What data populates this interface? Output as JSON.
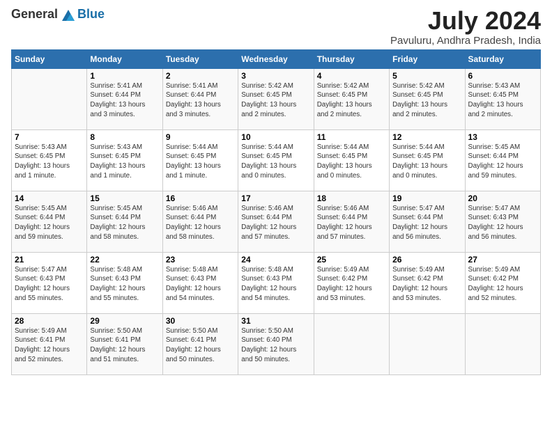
{
  "header": {
    "logo_general": "General",
    "logo_blue": "Blue",
    "month_title": "July 2024",
    "location": "Pavuluru, Andhra Pradesh, India"
  },
  "columns": [
    "Sunday",
    "Monday",
    "Tuesday",
    "Wednesday",
    "Thursday",
    "Friday",
    "Saturday"
  ],
  "weeks": [
    [
      {
        "day": "",
        "info": ""
      },
      {
        "day": "1",
        "info": "Sunrise: 5:41 AM\nSunset: 6:44 PM\nDaylight: 13 hours\nand 3 minutes."
      },
      {
        "day": "2",
        "info": "Sunrise: 5:41 AM\nSunset: 6:44 PM\nDaylight: 13 hours\nand 3 minutes."
      },
      {
        "day": "3",
        "info": "Sunrise: 5:42 AM\nSunset: 6:45 PM\nDaylight: 13 hours\nand 2 minutes."
      },
      {
        "day": "4",
        "info": "Sunrise: 5:42 AM\nSunset: 6:45 PM\nDaylight: 13 hours\nand 2 minutes."
      },
      {
        "day": "5",
        "info": "Sunrise: 5:42 AM\nSunset: 6:45 PM\nDaylight: 13 hours\nand 2 minutes."
      },
      {
        "day": "6",
        "info": "Sunrise: 5:43 AM\nSunset: 6:45 PM\nDaylight: 13 hours\nand 2 minutes."
      }
    ],
    [
      {
        "day": "7",
        "info": "Sunrise: 5:43 AM\nSunset: 6:45 PM\nDaylight: 13 hours\nand 1 minute."
      },
      {
        "day": "8",
        "info": "Sunrise: 5:43 AM\nSunset: 6:45 PM\nDaylight: 13 hours\nand 1 minute."
      },
      {
        "day": "9",
        "info": "Sunrise: 5:44 AM\nSunset: 6:45 PM\nDaylight: 13 hours\nand 1 minute."
      },
      {
        "day": "10",
        "info": "Sunrise: 5:44 AM\nSunset: 6:45 PM\nDaylight: 13 hours\nand 0 minutes."
      },
      {
        "day": "11",
        "info": "Sunrise: 5:44 AM\nSunset: 6:45 PM\nDaylight: 13 hours\nand 0 minutes."
      },
      {
        "day": "12",
        "info": "Sunrise: 5:44 AM\nSunset: 6:45 PM\nDaylight: 13 hours\nand 0 minutes."
      },
      {
        "day": "13",
        "info": "Sunrise: 5:45 AM\nSunset: 6:44 PM\nDaylight: 12 hours\nand 59 minutes."
      }
    ],
    [
      {
        "day": "14",
        "info": "Sunrise: 5:45 AM\nSunset: 6:44 PM\nDaylight: 12 hours\nand 59 minutes."
      },
      {
        "day": "15",
        "info": "Sunrise: 5:45 AM\nSunset: 6:44 PM\nDaylight: 12 hours\nand 58 minutes."
      },
      {
        "day": "16",
        "info": "Sunrise: 5:46 AM\nSunset: 6:44 PM\nDaylight: 12 hours\nand 58 minutes."
      },
      {
        "day": "17",
        "info": "Sunrise: 5:46 AM\nSunset: 6:44 PM\nDaylight: 12 hours\nand 57 minutes."
      },
      {
        "day": "18",
        "info": "Sunrise: 5:46 AM\nSunset: 6:44 PM\nDaylight: 12 hours\nand 57 minutes."
      },
      {
        "day": "19",
        "info": "Sunrise: 5:47 AM\nSunset: 6:44 PM\nDaylight: 12 hours\nand 56 minutes."
      },
      {
        "day": "20",
        "info": "Sunrise: 5:47 AM\nSunset: 6:43 PM\nDaylight: 12 hours\nand 56 minutes."
      }
    ],
    [
      {
        "day": "21",
        "info": "Sunrise: 5:47 AM\nSunset: 6:43 PM\nDaylight: 12 hours\nand 55 minutes."
      },
      {
        "day": "22",
        "info": "Sunrise: 5:48 AM\nSunset: 6:43 PM\nDaylight: 12 hours\nand 55 minutes."
      },
      {
        "day": "23",
        "info": "Sunrise: 5:48 AM\nSunset: 6:43 PM\nDaylight: 12 hours\nand 54 minutes."
      },
      {
        "day": "24",
        "info": "Sunrise: 5:48 AM\nSunset: 6:43 PM\nDaylight: 12 hours\nand 54 minutes."
      },
      {
        "day": "25",
        "info": "Sunrise: 5:49 AM\nSunset: 6:42 PM\nDaylight: 12 hours\nand 53 minutes."
      },
      {
        "day": "26",
        "info": "Sunrise: 5:49 AM\nSunset: 6:42 PM\nDaylight: 12 hours\nand 53 minutes."
      },
      {
        "day": "27",
        "info": "Sunrise: 5:49 AM\nSunset: 6:42 PM\nDaylight: 12 hours\nand 52 minutes."
      }
    ],
    [
      {
        "day": "28",
        "info": "Sunrise: 5:49 AM\nSunset: 6:41 PM\nDaylight: 12 hours\nand 52 minutes."
      },
      {
        "day": "29",
        "info": "Sunrise: 5:50 AM\nSunset: 6:41 PM\nDaylight: 12 hours\nand 51 minutes."
      },
      {
        "day": "30",
        "info": "Sunrise: 5:50 AM\nSunset: 6:41 PM\nDaylight: 12 hours\nand 50 minutes."
      },
      {
        "day": "31",
        "info": "Sunrise: 5:50 AM\nSunset: 6:40 PM\nDaylight: 12 hours\nand 50 minutes."
      },
      {
        "day": "",
        "info": ""
      },
      {
        "day": "",
        "info": ""
      },
      {
        "day": "",
        "info": ""
      }
    ]
  ]
}
